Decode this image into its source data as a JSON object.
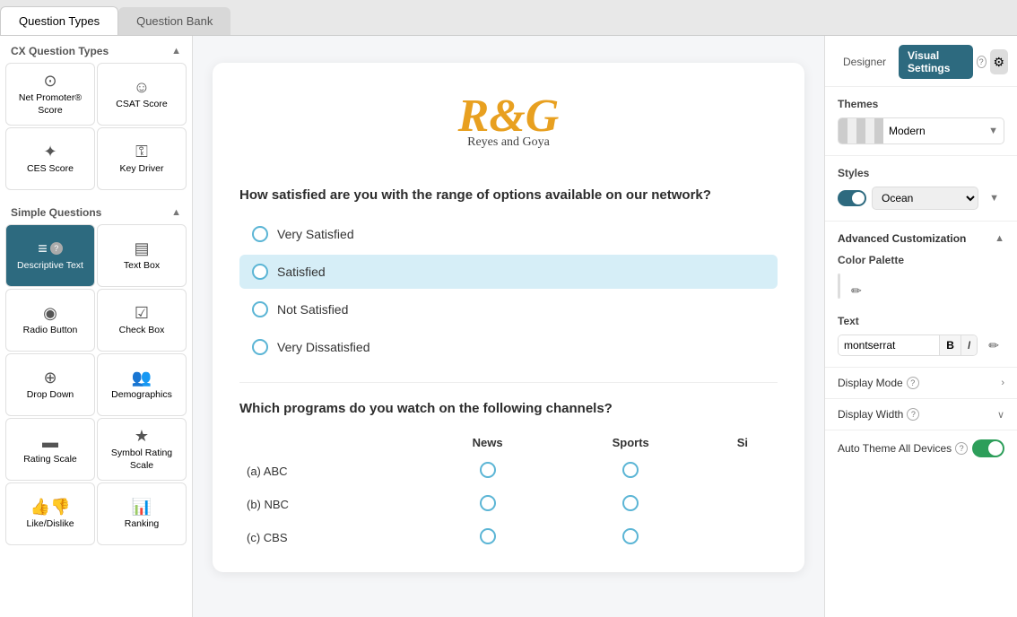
{
  "tabs": {
    "question_types": "Question Types",
    "question_bank": "Question Bank"
  },
  "sidebar": {
    "cx_section": "CX Question Types",
    "simple_section": "Simple Questions",
    "cx_items": [
      {
        "id": "nps",
        "icon": "⊙",
        "label": "Net Promoter® Score"
      },
      {
        "id": "csat",
        "icon": "☺",
        "label": "CSAT Score"
      },
      {
        "id": "ces",
        "icon": "✦",
        "label": "CES Score"
      },
      {
        "id": "key-driver",
        "icon": "✦",
        "label": "Key Driver"
      }
    ],
    "simple_items": [
      {
        "id": "descriptive-text",
        "icon": "≡",
        "label": "Descriptive Text",
        "active": true,
        "badge": "?"
      },
      {
        "id": "text-box",
        "icon": "▤",
        "label": "Text Box"
      },
      {
        "id": "radio-button",
        "icon": "◉",
        "label": "Radio Button"
      },
      {
        "id": "check-box",
        "icon": "☑",
        "label": "Check Box"
      },
      {
        "id": "drop-down",
        "icon": "⊕",
        "label": "Drop Down"
      },
      {
        "id": "demographics",
        "icon": "👥",
        "label": "Demographics"
      },
      {
        "id": "rating-scale",
        "icon": "▬",
        "label": "Rating Scale"
      },
      {
        "id": "symbol-rating-scale",
        "icon": "★",
        "label": "Symbol Rating Scale"
      },
      {
        "id": "like-dislike",
        "icon": "👍",
        "label": "Like/Dislike"
      },
      {
        "id": "ranking",
        "icon": "📊",
        "label": "Ranking"
      }
    ]
  },
  "survey": {
    "logo_text": "R&G",
    "logo_sub": "Reyes and Goya",
    "q1_text": "How satisfied are you with the range of options available on our network?",
    "q1_options": [
      {
        "label": "Very Satisfied",
        "selected": false
      },
      {
        "label": "Satisfied",
        "selected": true
      },
      {
        "label": "Not Satisfied",
        "selected": false
      },
      {
        "label": "Very Dissatisfied",
        "selected": false
      }
    ],
    "q2_text": "Which programs do you watch on the following channels?",
    "q2_columns": [
      "News",
      "Sports",
      "Si"
    ],
    "q2_rows": [
      "(a) ABC",
      "(b) NBC",
      "(c) CBS"
    ]
  },
  "right_panel": {
    "tab_designer": "Designer",
    "tab_visual": "Visual Settings",
    "themes_label": "Themes",
    "themes_value": "Modern",
    "styles_label": "Styles",
    "styles_value": "Ocean",
    "adv_label": "Advanced Customization",
    "color_palette_label": "Color Palette",
    "colors": [
      "#1a4a5a",
      "#5bb5d5",
      "#a8d8ea",
      "#ffffff"
    ],
    "text_label": "Text",
    "font_value": "montserrat",
    "bold_label": "B",
    "italic_label": "I",
    "display_mode_label": "Display Mode",
    "display_width_label": "Display Width",
    "auto_theme_label": "Auto Theme All Devices"
  }
}
